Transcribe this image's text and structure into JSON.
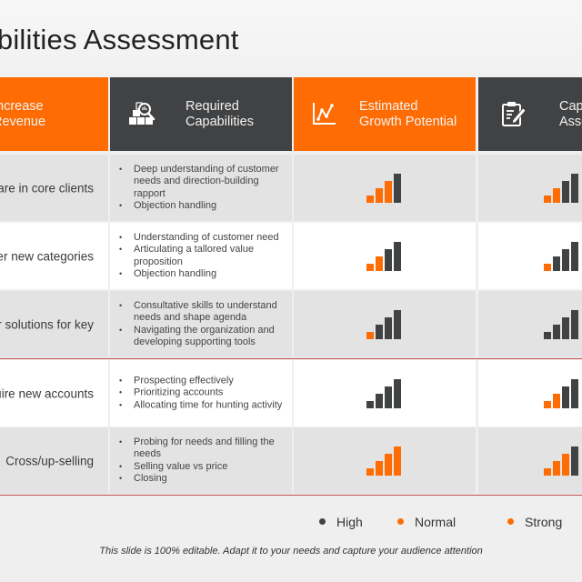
{
  "title": "Capabilities Assessment",
  "colors": {
    "orange": "#fe6c03",
    "dark": "#414243",
    "rowGray": "#e3e3e3",
    "rowWhite": "#ffffff",
    "divider": "#c0504d"
  },
  "headers": [
    {
      "label_line1": "Increase",
      "label_line2": "Revenue",
      "icon": "none",
      "style": "orange"
    },
    {
      "label_line1": "Required",
      "label_line2": "Capabilities",
      "icon": "boxes-search-icon",
      "style": "dark"
    },
    {
      "label_line1": "Estimated",
      "label_line2": "Growth Potential",
      "icon": "line-chart-icon",
      "style": "orange"
    },
    {
      "label_line1": "Capability",
      "label_line2": "Assessment",
      "icon": "clipboard-edit-icon",
      "style": "dark"
    }
  ],
  "rows": [
    {
      "goal": "Increase share in core clients",
      "capabilities": [
        "Deep understanding of customer needs and direction-building rapport",
        "Objection handling"
      ],
      "growth_potential_filled": 3,
      "capability_assessment_filled": 2,
      "style": "gray"
    },
    {
      "goal": "Enter new categories",
      "capabilities": [
        "Understanding of customer need",
        "Articulating a tallored value proposition",
        "Objection handling"
      ],
      "growth_potential_filled": 2,
      "capability_assessment_filled": 1,
      "style": "white"
    },
    {
      "goal": "Offer solutions for key",
      "capabilities": [
        "Consultative skills to understand needs and shape agenda",
        "Navigating the organization and developing supporting tools"
      ],
      "growth_potential_filled": 1,
      "capability_assessment_filled": 0,
      "style": "gray"
    },
    {
      "goal": "Acquire new accounts",
      "capabilities": [
        "Prospecting effectively",
        "Prioritizing accounts",
        "Allocating time for hunting activity"
      ],
      "growth_potential_filled": 0,
      "capability_assessment_filled": 2,
      "style": "white"
    },
    {
      "goal": "Cross/up-selling",
      "capabilities": [
        "Probing for needs and filling the needs",
        "Selling value vs price",
        "Closing"
      ],
      "growth_potential_filled": 4,
      "capability_assessment_filled": 3,
      "style": "gray"
    }
  ],
  "bar_levels": 4,
  "legend": [
    {
      "label": "High",
      "color": "#414243"
    },
    {
      "label": "Normal",
      "color": "#fe6c03"
    },
    {
      "label": "Strong",
      "color": "#fe6c03"
    }
  ],
  "footer": "This slide is 100% editable. Adapt it to your needs and capture your audience attention"
}
